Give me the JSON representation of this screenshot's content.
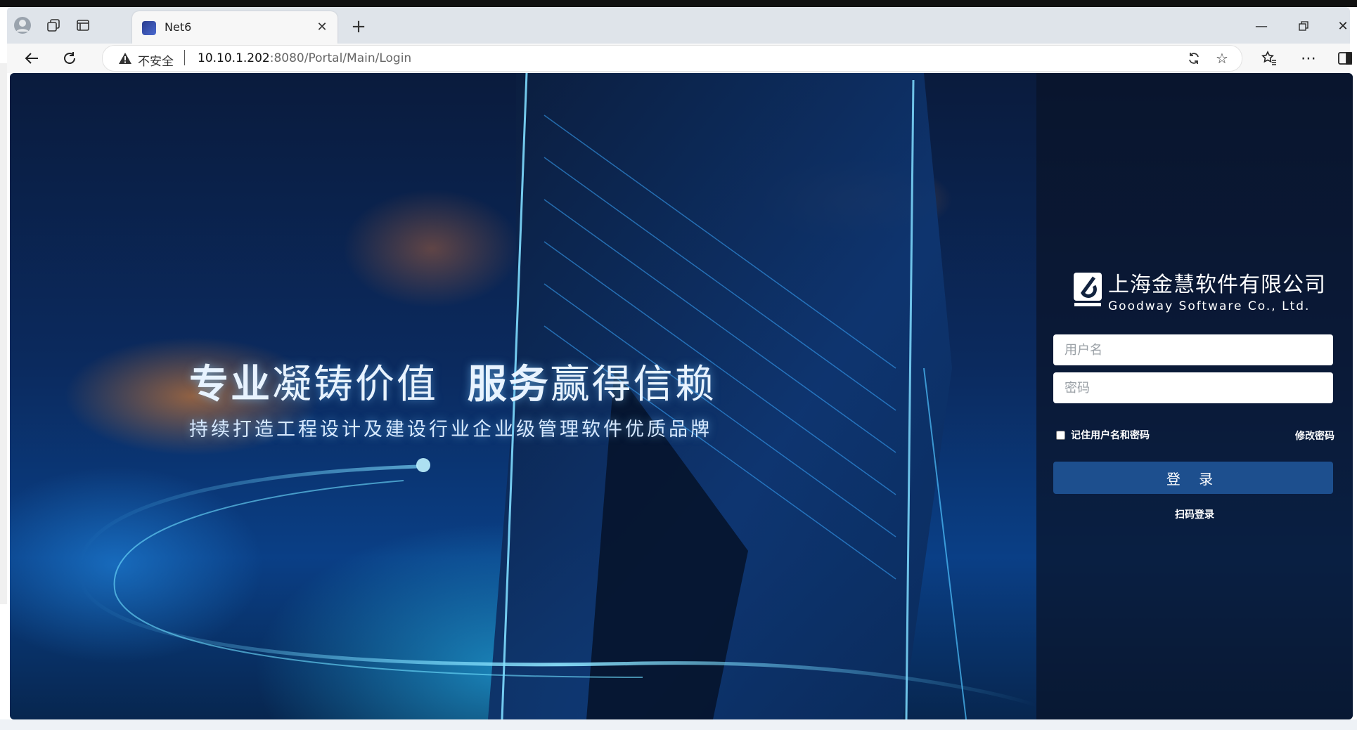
{
  "browser": {
    "tab_title": "Net6",
    "insecure_label": "不安全",
    "url_host": "10.10.1.202",
    "url_rest": ":8080/Portal/Main/Login"
  },
  "page": {
    "slogan_bold_1": "专业",
    "slogan_rest_1": "凝铸价值",
    "slogan_bold_2": "服务",
    "slogan_rest_2": "赢得信赖",
    "slogan_sub": "持续打造工程设计及建设行业企业级管理软件优质品牌"
  },
  "login": {
    "company_cn": "上海金慧软件有限公司",
    "company_en": "Goodway Software Co., Ltd.",
    "username_placeholder": "用户名",
    "password_placeholder": "密码",
    "remember_label": "记住用户名和密码",
    "change_password": "修改密码",
    "login_button": "登 录",
    "scan_login": "扫码登录"
  },
  "colors": {
    "login_button": "#1d4f8e",
    "panel_bg": "#0a1428"
  }
}
